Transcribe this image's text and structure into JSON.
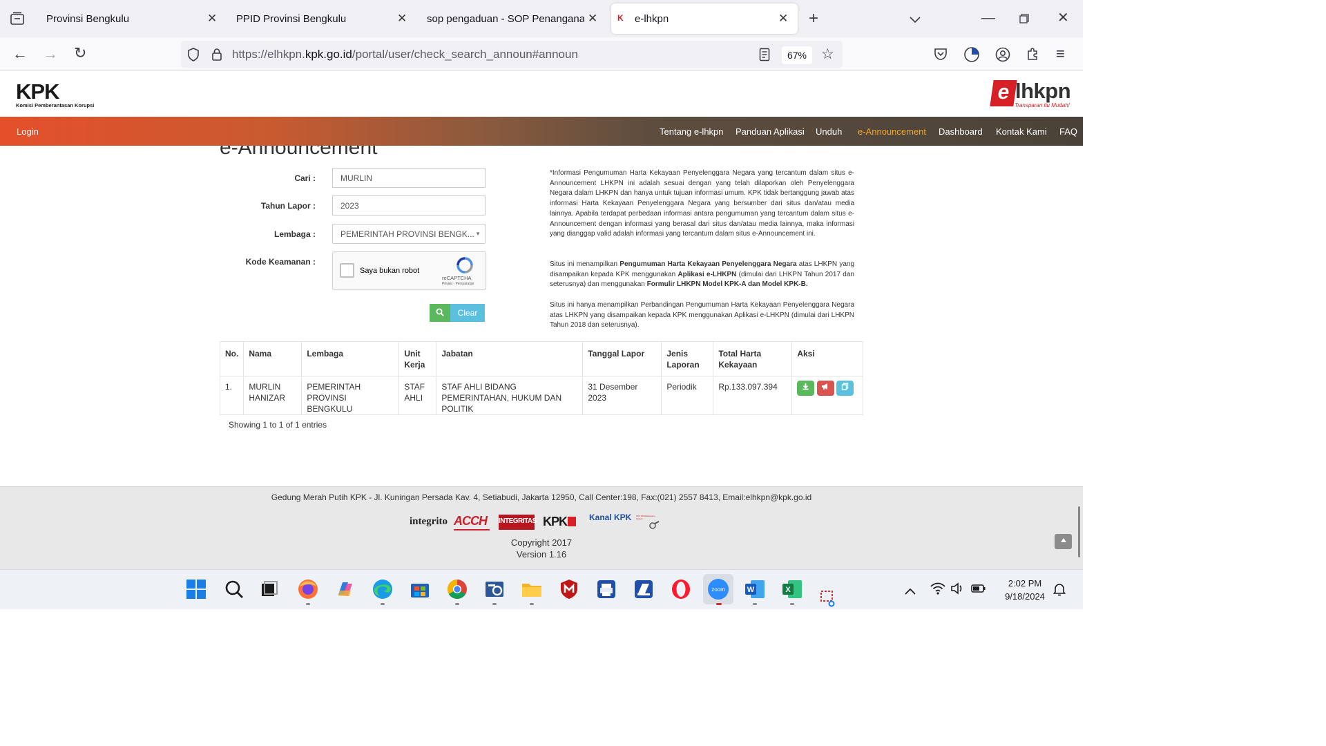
{
  "browser": {
    "tabs": [
      {
        "title": "Provinsi Bengkulu",
        "active": false
      },
      {
        "title": "PPID Provinsi Bengkulu",
        "active": false
      },
      {
        "title": "sop pengaduan - SOP Penanganan I",
        "active": false
      },
      {
        "title": "e-lhkpn",
        "active": true
      }
    ],
    "url_prefix": "https://elhkpn.",
    "url_domain": "kpk.go.id",
    "url_path": "/portal/user/check_search_announ#announ",
    "zoom": "67%"
  },
  "header": {
    "kpk_logo_text": "KPK",
    "kpk_logo_subtitle": "Komisi Pemberantasan Korupsi",
    "elhkpn_logo_e": "e",
    "elhkpn_logo_text": "lhkpn",
    "elhkpn_tagline": "Transparan itu Mudah!"
  },
  "nav": {
    "login": "Login",
    "items": [
      "Tentang e-lhkpn",
      "Panduan Aplikasi",
      "Unduh",
      "e-Announcement",
      "Dashboard",
      "Kontak Kami",
      "FAQ"
    ],
    "active": "e-Announcement"
  },
  "page": {
    "heading": "e-Announcement"
  },
  "form": {
    "cari_label": "Cari :",
    "cari_value": "MURLIN",
    "tahun_label": "Tahun Lapor :",
    "tahun_value": "2023",
    "lembaga_label": "Lembaga :",
    "lembaga_value": "PEMERINTAH PROVINSI BENGK...",
    "kode_label": "Kode Keamanan :",
    "captcha_label": "Saya bukan robot",
    "captcha_brand": "reCAPTCHA",
    "captcha_links": "Privasi - Persyaratan",
    "clear_label": "Clear"
  },
  "info": {
    "p1": "*Informasi Pengumuman Harta Kekayaan Penyelenggara Negara yang tercantum dalam situs e-Announcement LHKPN ini adalah sesuai dengan yang telah dilaporkan oleh Penyelenggara Negara dalam LHKPN dan hanya untuk tujuan informasi umum. KPK tidak bertanggung jawab atas informasi Harta Kekayaan Penyelenggara Negara yang bersumber dari situs dan/atau media lainnya. Apabila terdapat perbedaan informasi antara pengumuman yang tercantum dalam situs e-Announcement dengan informasi yang berasal dari situs dan/atau media lainnya, maka informasi yang dianggap valid adalah informasi yang tercantum dalam situs e-Announcement ini.",
    "p2_a": "Situs ini menampilkan ",
    "p2_b": "Pengumuman Harta Kekayaan Penyelenggara Negara",
    "p2_c": " atas LHKPN yang disampaikan kepada KPK menggunakan ",
    "p2_d": "Aplikasi e-LHKPN",
    "p2_e": " (dimulai dari LHKPN Tahun 2017 dan seterusnya) dan menggunakan ",
    "p2_f": "Formulir LHKPN Model KPK-A dan Model KPK-B.",
    "p3": "Situs ini hanya menampilkan Perbandingan Pengumuman Harta Kekayaan Penyelenggara Negara atas LHKPN yang disampaikan kepada KPK menggunakan Aplikasi e-LHKPN (dimulai dari LHKPN Tahun 2018 dan seterusnya)."
  },
  "table": {
    "headers": [
      "No.",
      "Nama",
      "Lembaga",
      "Unit Kerja",
      "Jabatan",
      "Tanggal Lapor",
      "Jenis Laporan",
      "Total Harta Kekayaan",
      "Aksi"
    ],
    "rows": [
      {
        "no": "1.",
        "nama": "MURLIN HANIZAR",
        "lembaga": "PEMERINTAH PROVINSI BENGKULU",
        "unit": "STAF AHLI",
        "jabatan": "STAF AHLI BIDANG PEMERINTAHAN, HUKUM DAN POLITIK",
        "tanggal": "31 Desember 2023",
        "jenis": "Periodik",
        "total": "Rp.133.097.394"
      }
    ],
    "entries": "Showing 1 to 1 of 1 entries"
  },
  "footer": {
    "address": "Gedung Merah Putih KPK - Jl. Kuningan Persada Kav. 4, Setiabudi, Jakarta 12950, Call Center:198, Fax:(021) 2557 8413, Email:elhkpn@kpk.go.id",
    "logos": [
      "integrito",
      "ACCH",
      "INTEGRITAS",
      "KPK",
      "Kanal KPK",
      "KPK Whistleblower's System"
    ],
    "copyright": "Copyright 2017",
    "version": "Version 1.16"
  },
  "taskbar": {
    "time": "2:02 PM",
    "date": "9/18/2024"
  },
  "colors": {
    "nav_active": "#f5a623",
    "btn_green": "#5cb85c",
    "btn_info": "#5bc0de",
    "btn_red": "#d9534f",
    "kpk_red": "#d71f26"
  }
}
